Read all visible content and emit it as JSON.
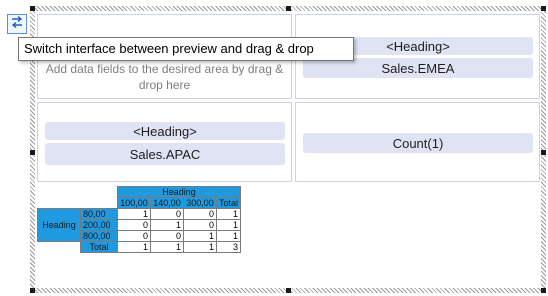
{
  "toolbar": {
    "toggle_icon": "swap-arrows-icon",
    "tooltip": "Switch interface between preview and drag & drop"
  },
  "panels": {
    "drop_area_hint": "Add data fields to the desired area by drag & drop here",
    "top_right": {
      "heading": "<Heading>",
      "field": "Sales.EMEA"
    },
    "middle_left": {
      "heading": "<Heading>",
      "field": "Sales.APAC"
    },
    "middle_right": {
      "field": "Count(1)"
    }
  },
  "pivot": {
    "column_header": "Heading",
    "columns": [
      "100,00",
      "140,00",
      "300,00",
      "Total"
    ],
    "row_header": "Heading",
    "rows": [
      {
        "label": "80,00",
        "values": [
          "1",
          "0",
          "0",
          "1"
        ]
      },
      {
        "label": "200,00",
        "values": [
          "0",
          "1",
          "0",
          "1"
        ]
      },
      {
        "label": "800,00",
        "values": [
          "0",
          "0",
          "1",
          "1"
        ]
      },
      {
        "label": "Total",
        "values": [
          "1",
          "1",
          "1",
          "3"
        ]
      }
    ]
  },
  "colors": {
    "accent": "#1f9ae0",
    "pill": "#dfe3f3",
    "panel_border": "#c9d3ee"
  }
}
